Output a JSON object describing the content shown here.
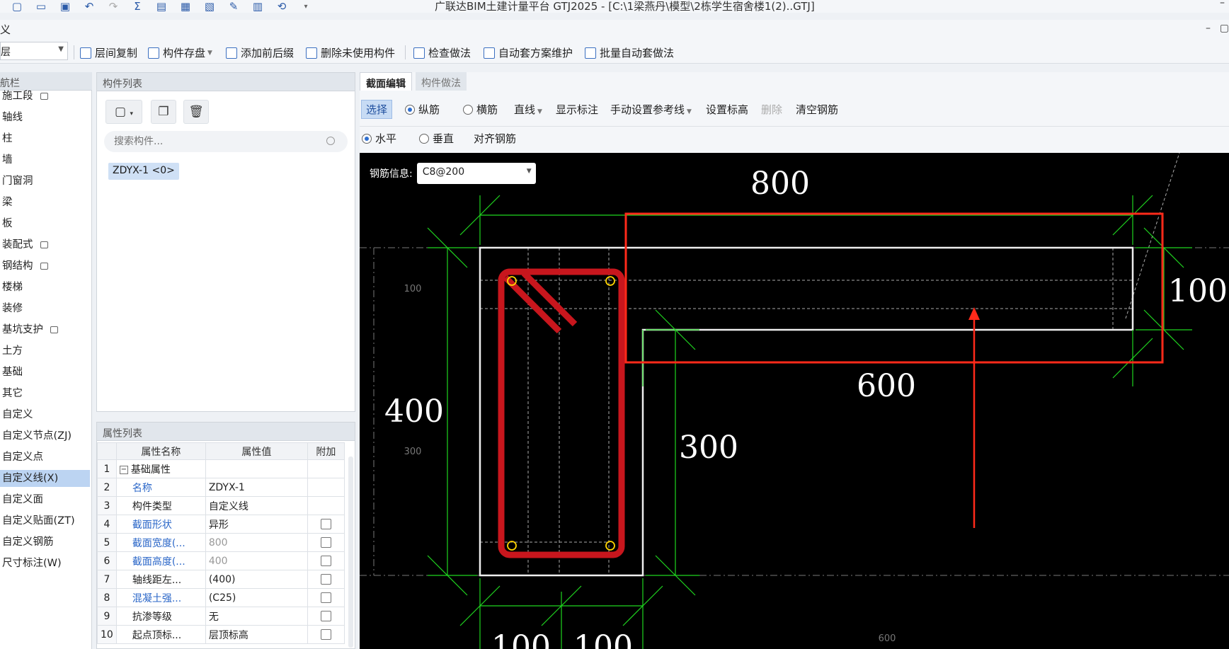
{
  "app": {
    "title": "广联达BIM土建计量平台 GTJ2025 - [C:\\1梁燕丹\\模型\\2栋学生宿舍楼1(2)..GTJ]",
    "menu_label": "义"
  },
  "toolbar": {
    "floor_value": "层",
    "buttons": [
      "层间复制",
      "构件存盘",
      "添加前后缀",
      "删除未使用构件",
      "检查做法",
      "自动套方案维护",
      "批量自动套做法"
    ]
  },
  "nav": {
    "title": "航栏",
    "items": [
      {
        "label": "施工段",
        "locked": true
      },
      {
        "label": "轴线"
      },
      {
        "label": "柱"
      },
      {
        "label": "墙"
      },
      {
        "label": "门窗洞"
      },
      {
        "label": "梁"
      },
      {
        "label": "板"
      },
      {
        "label": "装配式",
        "locked": true
      },
      {
        "label": "钢结构",
        "locked": true
      },
      {
        "label": "楼梯"
      },
      {
        "label": "装修"
      },
      {
        "label": "基坑支护",
        "locked": true
      },
      {
        "label": "土方"
      },
      {
        "label": "基础"
      },
      {
        "label": "其它"
      },
      {
        "label": "自定义"
      },
      {
        "label": "自定义节点(ZJ)"
      },
      {
        "label": "自定义点"
      },
      {
        "label": "自定义线(X)",
        "active": true
      },
      {
        "label": "自定义面"
      },
      {
        "label": "自定义贴面(ZT)"
      },
      {
        "label": "自定义钢筋"
      },
      {
        "label": "尺寸标注(W)"
      }
    ]
  },
  "components": {
    "title": "构件列表",
    "search_placeholder": "搜索构件...",
    "items": [
      "ZDYX-1 <0>"
    ]
  },
  "properties": {
    "title": "属性列表",
    "headers": [
      "属性名称",
      "属性值",
      "附加"
    ],
    "rows": [
      {
        "idx": "1",
        "name": "基础属性",
        "value": "",
        "group": true
      },
      {
        "idx": "2",
        "name": "名称",
        "value": "ZDYX-1",
        "blue": true
      },
      {
        "idx": "3",
        "name": "构件类型",
        "value": "自定义线"
      },
      {
        "idx": "4",
        "name": "截面形状",
        "value": "异形",
        "blue": true,
        "check": true
      },
      {
        "idx": "5",
        "name": "截面宽度(...",
        "value": "800",
        "blue": true,
        "grey": true,
        "check": true
      },
      {
        "idx": "6",
        "name": "截面高度(...",
        "value": "400",
        "blue": true,
        "grey": true,
        "check": true
      },
      {
        "idx": "7",
        "name": "轴线距左...",
        "value": "(400)",
        "check": true
      },
      {
        "idx": "8",
        "name": "混凝土强...",
        "value": "(C25)",
        "blue": true,
        "check": true
      },
      {
        "idx": "9",
        "name": "抗渗等级",
        "value": "无",
        "check": true
      },
      {
        "idx": "10",
        "name": "起点顶标...",
        "value": "层顶标高",
        "check": true
      }
    ]
  },
  "editor": {
    "tabs": [
      "截面编辑",
      "构件做法"
    ],
    "bar1": {
      "select": "选择",
      "longitudinal": "纵筋",
      "transverse": "横筋",
      "line": "直线",
      "show_dims": "显示标注",
      "set_ref_line": "手动设置参考线",
      "set_elev": "设置标高",
      "delete": "删除",
      "clear_rebar": "清空钢筋"
    },
    "bar2": {
      "horizontal": "水平",
      "vertical": "垂直",
      "align": "对齐钢筋"
    },
    "rebar_info_label": "钢筋信息:",
    "rebar_info_value": "C8@200"
  },
  "drawing": {
    "dims": {
      "top": "800",
      "right": "100",
      "left": "400",
      "middle": "600",
      "lower": "300",
      "bottom1": "100",
      "bottom2": "100"
    },
    "small_labels": {
      "a": "100",
      "b": "300",
      "c": "600"
    }
  },
  "colors": {
    "accent": "#2f6fd0",
    "dim_green": "#1fd61f",
    "rebar_red": "#c8161d",
    "annotation_red": "#ff2a1a",
    "canvas_bg": "#000000"
  }
}
